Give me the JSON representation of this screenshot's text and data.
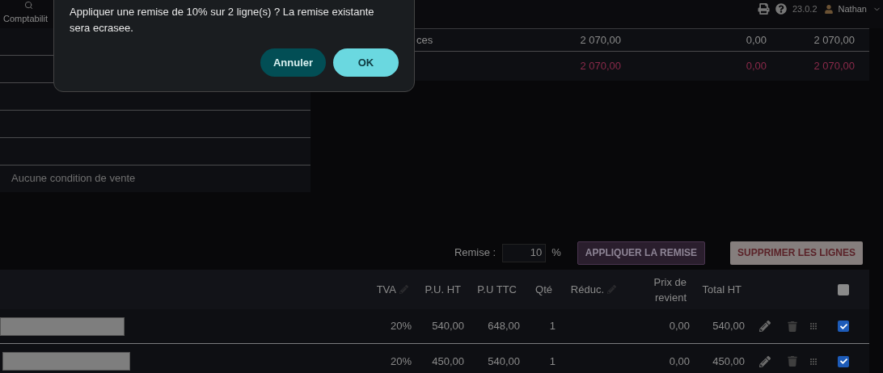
{
  "top_bar": {
    "menu_item": "Comptabilit",
    "version": "23.0.2",
    "user": "Nathan"
  },
  "dialog": {
    "message": "Appliquer une remise de 10% sur 2 ligne(s) ? La remise existante sera ecrasee.",
    "buttons": [
      {
        "label": "Annuler",
        "kind": "secondary"
      },
      {
        "label": "OK",
        "kind": "primary"
      }
    ]
  },
  "totals": {
    "rows": [
      {
        "label": "ces",
        "values": [
          "2 070,00",
          "0,00",
          "2 070,00"
        ],
        "kind": "normal"
      },
      {
        "values": [
          "2 070,00",
          "0,00",
          "2 070,00"
        ],
        "kind": "total"
      }
    ]
  },
  "conditions": {
    "empty_text": "Aucune condition de vente"
  },
  "discount": {
    "label": "Remise :",
    "value": "10",
    "unit": "%",
    "apply_button": "APPLIQUER LA REMISE",
    "delete_button": "SUPPRIMER LES LIGNES"
  },
  "lines_table": {
    "select_all": {
      "checked": false
    },
    "columns": [
      {
        "label": "TVA",
        "editable": true
      },
      {
        "label": "P.U. HT",
        "editable": false
      },
      {
        "label": "P.U TTC",
        "editable": false
      },
      {
        "label": "Qté",
        "editable": false
      },
      {
        "label": "Réduc.",
        "editable": true
      },
      {
        "label": "Prix de revient",
        "editable": false
      },
      {
        "label": "Total HT",
        "editable": false
      }
    ],
    "rows": [
      {
        "cells": [
          "20%",
          "540,00",
          "648,00",
          "1",
          "",
          "0,00",
          "540,00"
        ],
        "checked": true
      },
      {
        "cells": [
          "20%",
          "450,00",
          "540,00",
          "1",
          "",
          "0,00",
          "450,00"
        ],
        "checked": true
      }
    ]
  }
}
